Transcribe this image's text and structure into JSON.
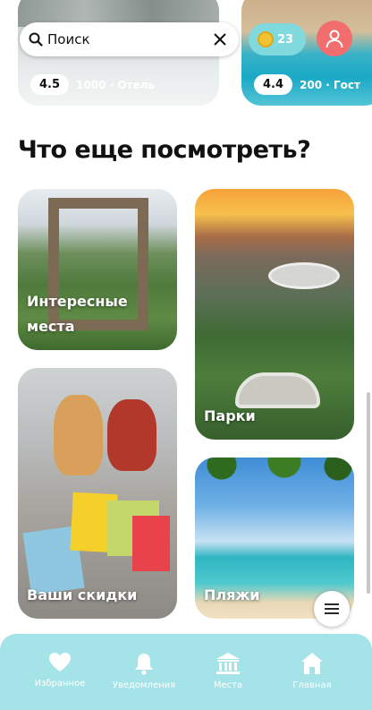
{
  "search": {
    "value": "Поиск"
  },
  "coins": {
    "count": "23"
  },
  "hotel_cards": [
    {
      "rating": "4.5",
      "info": "1000 · Отель"
    },
    {
      "rating": "4.4",
      "info": "200 · Гост"
    }
  ],
  "section": {
    "title": "Что еще посмотреть?"
  },
  "tiles": {
    "interesting": "Интересные места",
    "parks": "Парки",
    "discounts": "Ваши скидки",
    "beaches": "Пляжи"
  },
  "nav": {
    "favorites": "Избранное",
    "notifications": "Уведомления",
    "places": "Места",
    "home": "Главная"
  },
  "icons": [
    "search-icon",
    "close-icon",
    "coin-icon",
    "user-icon",
    "menu-icon",
    "heart-icon",
    "bell-icon",
    "landmark-icon",
    "home-icon"
  ],
  "colors": {
    "accent": "#a4e3e8",
    "coins_bg": "#7fd9dd",
    "avatar_bg": "#f26d6d"
  }
}
